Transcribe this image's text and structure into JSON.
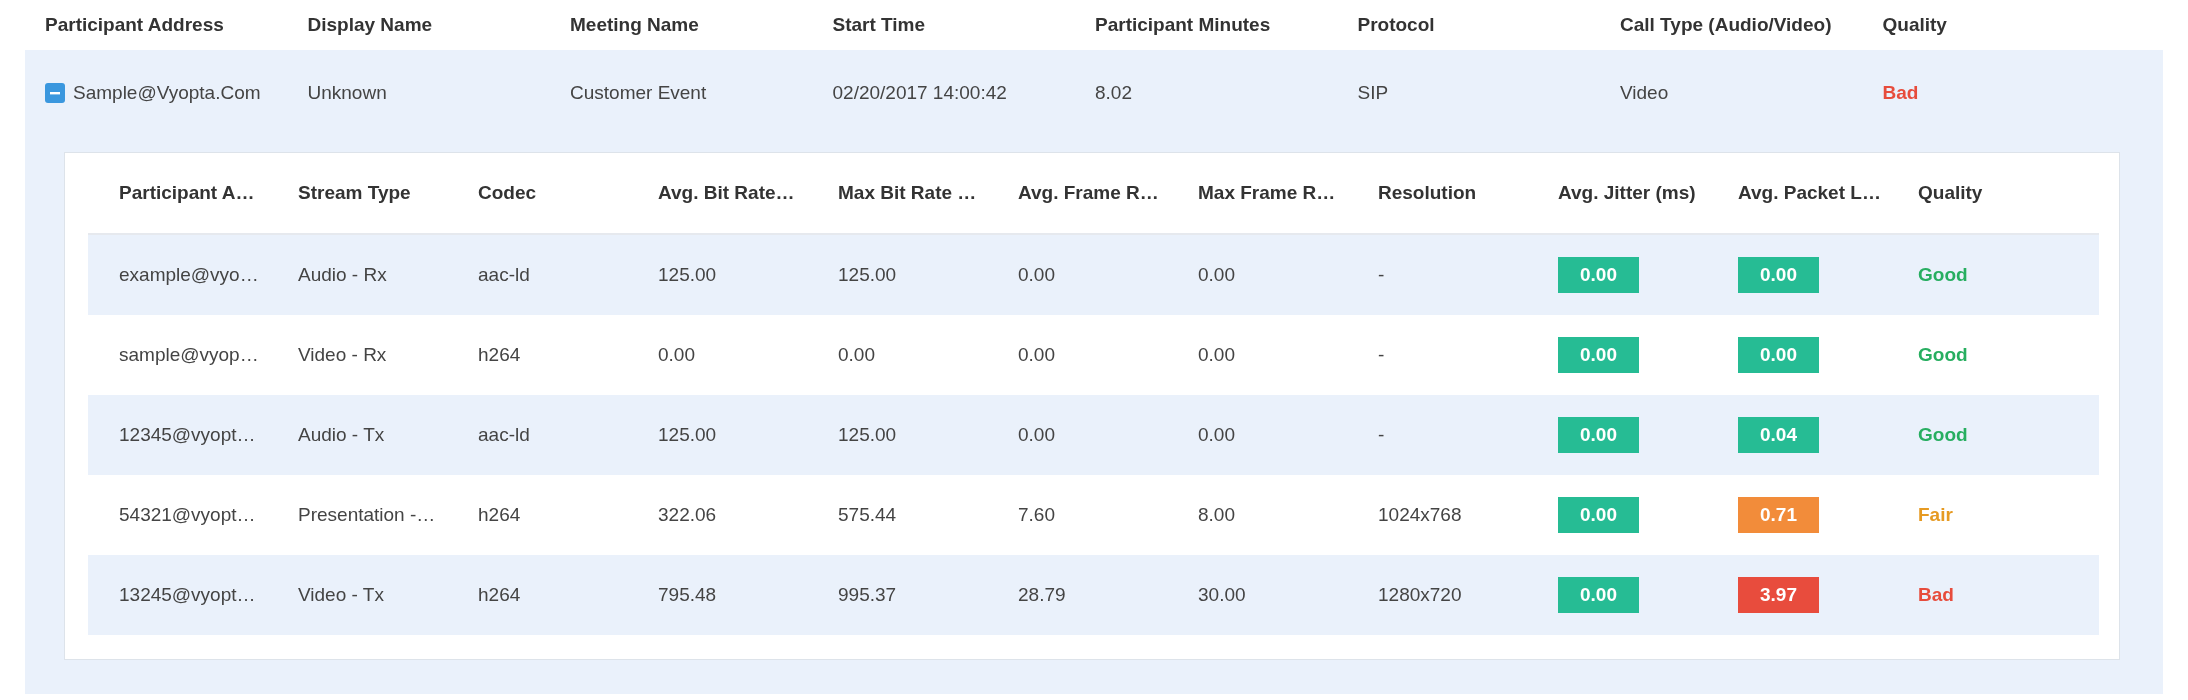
{
  "table": {
    "columns": [
      "Participant Address",
      "Display Name",
      "Meeting Name",
      "Start Time",
      "Participant Minutes",
      "Protocol",
      "Call Type (Audio/Video)",
      "Quality"
    ],
    "rows": [
      {
        "expanded": true,
        "cells": [
          "Sample@Vyopta.Com",
          "Unknown",
          "Customer Event",
          "02/20/2017 14:00:42",
          "8.02",
          "SIP",
          "Video"
        ],
        "quality": {
          "text": "Bad",
          "color": "#e74c3c"
        },
        "detail": {
          "columns": [
            "Participant A…",
            "Stream Type",
            "Codec",
            "Avg. Bit Rate…",
            "Max Bit Rate …",
            "Avg. Frame R…",
            "Max Frame R…",
            "Resolution",
            "Avg. Jitter (ms)",
            "Avg. Packet L…",
            "Quality"
          ],
          "rows": [
            {
              "cells": [
                "example@vyo…",
                "Audio - Rx",
                "aac-ld",
                "125.00",
                "125.00",
                "0.00",
                "0.00",
                "-"
              ],
              "jitter": {
                "text": "0.00",
                "color": "#26bc94"
              },
              "packet_loss": {
                "text": "0.00",
                "color": "#26bc94"
              },
              "quality": {
                "text": "Good",
                "color": "#27ae60"
              }
            },
            {
              "cells": [
                "sample@vyop…",
                "Video - Rx",
                "h264",
                "0.00",
                "0.00",
                "0.00",
                "0.00",
                "-"
              ],
              "jitter": {
                "text": "0.00",
                "color": "#26bc94"
              },
              "packet_loss": {
                "text": "0.00",
                "color": "#26bc94"
              },
              "quality": {
                "text": "Good",
                "color": "#27ae60"
              }
            },
            {
              "cells": [
                "12345@vyopt…",
                "Audio - Tx",
                "aac-ld",
                "125.00",
                "125.00",
                "0.00",
                "0.00",
                "-"
              ],
              "jitter": {
                "text": "0.00",
                "color": "#26bc94"
              },
              "packet_loss": {
                "text": "0.04",
                "color": "#26bc94"
              },
              "quality": {
                "text": "Good",
                "color": "#27ae60"
              }
            },
            {
              "cells": [
                "54321@vyopt…",
                "Presentation -…",
                "h264",
                "322.06",
                "575.44",
                "7.60",
                "8.00",
                "1024x768"
              ],
              "jitter": {
                "text": "0.00",
                "color": "#26bc94"
              },
              "packet_loss": {
                "text": "0.71",
                "color": "#f28c3a"
              },
              "quality": {
                "text": "Fair",
                "color": "#e69a22"
              }
            },
            {
              "cells": [
                "13245@vyopt…",
                "Video - Tx",
                "h264",
                "795.48",
                "995.37",
                "28.79",
                "30.00",
                "1280x720"
              ],
              "jitter": {
                "text": "0.00",
                "color": "#26bc94"
              },
              "packet_loss": {
                "text": "3.97",
                "color": "#e84c3d"
              },
              "quality": {
                "text": "Bad",
                "color": "#e74c3c"
              }
            }
          ]
        }
      }
    ]
  }
}
